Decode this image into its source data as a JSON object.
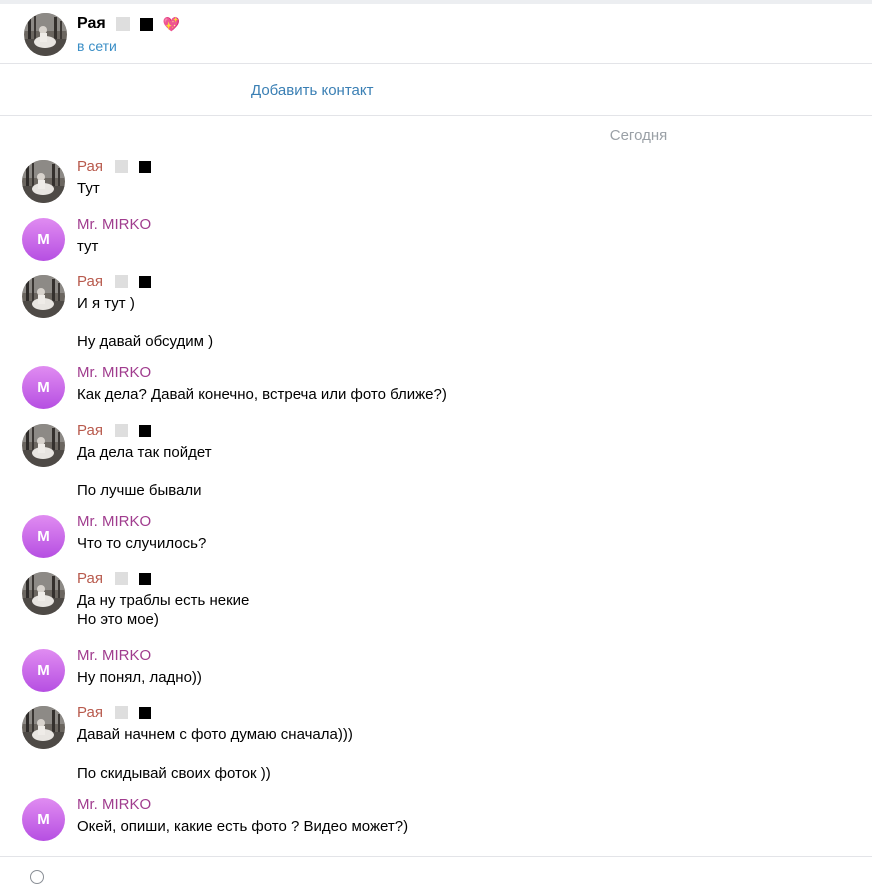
{
  "header": {
    "name": "Рая",
    "heart": "💖",
    "status": "в сети"
  },
  "add_contact": "Добавить контакт",
  "date_separator": "Сегодня",
  "messages": [
    {
      "sender": "Рая",
      "lines": [
        "Тут"
      ]
    },
    {
      "sender": "Mr. MIRKO",
      "initial": "M",
      "lines": [
        "тут"
      ]
    },
    {
      "sender": "Рая",
      "lines": [
        "И я тут )"
      ]
    },
    {
      "lines": [
        "Ну давай обсудим )"
      ]
    },
    {
      "sender": "Mr. MIRKO",
      "initial": "M",
      "lines": [
        "Как дела? Давай конечно, встреча или фото ближе?)"
      ]
    },
    {
      "sender": "Рая",
      "lines": [
        "Да дела так пойдет"
      ]
    },
    {
      "lines": [
        "По лучше бывали"
      ]
    },
    {
      "sender": "Mr. MIRKO",
      "initial": "M",
      "lines": [
        "Что то случилось?"
      ]
    },
    {
      "sender": "Рая",
      "lines": [
        "Да ну траблы есть некие",
        "Но это мое)"
      ]
    },
    {
      "sender": "Mr. MIRKO",
      "initial": "M",
      "lines": [
        "Ну понял, ладно))"
      ]
    },
    {
      "sender": "Рая",
      "lines": [
        "Давай начнем с фото думаю сначала)))"
      ]
    },
    {
      "lines": [
        "По скидывай своих фоток ))"
      ]
    },
    {
      "sender": "Mr. MIRKO",
      "initial": "M",
      "lines": [
        "Окей, опиши, какие есть фото ? Видео может?)"
      ]
    }
  ],
  "colors": {
    "link": "#3a8ec6",
    "raya_name": "#b85a4d",
    "mirko_name": "#a03c8e",
    "mirko_avatar": "#c565e8"
  },
  "icons": [
    "photo-avatar",
    "square-light-emoji",
    "square-dark-emoji",
    "heart-emoji",
    "attach-icon"
  ]
}
